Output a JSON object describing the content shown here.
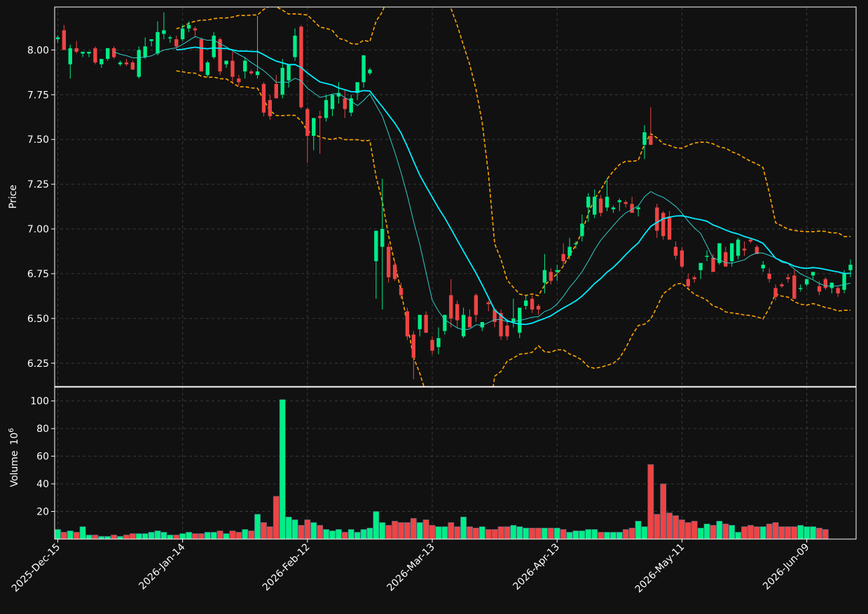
{
  "chart_data": {
    "type": "candlestick",
    "colors": {
      "background": "#111111",
      "up": "#00ee88",
      "down": "#ee4444",
      "ma_fast": "#33cccc",
      "ma_slow": "#00eeff",
      "bands": "#ffa500",
      "grid": "#3a3a3a",
      "axis": "#ffffff"
    },
    "price_panel": {
      "ylabel": "Price",
      "ylim": [
        6.12,
        8.24
      ],
      "yticks": [
        "6.25",
        "6.50",
        "6.75",
        "7.00",
        "7.25",
        "7.50",
        "7.75",
        "8.00"
      ],
      "grid": true
    },
    "volume_panel": {
      "ylabel": "Volume",
      "ylabel_exponent": "10",
      "ylabel_exponent_power": "6",
      "ylim": [
        0,
        110
      ],
      "yticks": [
        "20",
        "40",
        "60",
        "80",
        "100"
      ],
      "grid": true
    },
    "xticks": [
      {
        "label": "2025-Dec-15",
        "index": 0
      },
      {
        "label": "2026-Jan-14",
        "index": 20
      },
      {
        "label": "2026-Feb-12",
        "index": 40
      },
      {
        "label": "2026-Mar-13",
        "index": 60
      },
      {
        "label": "2026-Apr-13",
        "index": 80
      },
      {
        "label": "2026-May-11",
        "index": 100
      },
      {
        "label": "2026-Jun-09",
        "index": 120
      }
    ],
    "ohlc": [
      [
        8.06,
        8.08,
        8.04,
        8.07
      ],
      [
        8.11,
        8.14,
        8.0,
        8.0
      ],
      [
        7.92,
        8.03,
        7.84,
        8.01
      ],
      [
        8.01,
        8.05,
        7.98,
        7.99
      ],
      [
        7.98,
        7.99,
        7.96,
        7.99
      ],
      [
        7.98,
        7.99,
        7.96,
        7.99
      ],
      [
        8.01,
        8.02,
        7.92,
        7.93
      ],
      [
        7.92,
        7.95,
        7.9,
        7.95
      ],
      [
        7.95,
        8.01,
        7.94,
        8.01
      ],
      [
        8.01,
        8.02,
        7.95,
        7.96
      ],
      [
        7.92,
        7.94,
        7.91,
        7.93
      ],
      [
        7.93,
        7.95,
        7.91,
        7.92
      ],
      [
        7.93,
        7.94,
        7.9,
        7.89
      ],
      [
        7.85,
        8.02,
        7.84,
        8.0
      ],
      [
        7.96,
        8.07,
        7.95,
        8.02
      ],
      [
        8.05,
        8.06,
        8.02,
        8.06
      ],
      [
        7.98,
        8.16,
        7.97,
        8.1
      ],
      [
        8.09,
        8.21,
        8.06,
        8.11
      ],
      [
        8.07,
        8.08,
        8.04,
        8.07
      ],
      [
        8.06,
        8.08,
        8.0,
        8.02
      ],
      [
        8.06,
        8.14,
        8.05,
        8.12
      ],
      [
        8.12,
        8.16,
        8.1,
        8.14
      ],
      [
        8.12,
        8.13,
        8.07,
        8.11
      ],
      [
        8.06,
        8.07,
        7.88,
        7.88
      ],
      [
        7.86,
        7.94,
        7.85,
        7.93
      ],
      [
        7.96,
        8.1,
        7.95,
        8.08
      ],
      [
        8.06,
        8.07,
        7.86,
        7.88
      ],
      [
        7.92,
        7.94,
        7.9,
        7.94
      ],
      [
        7.94,
        7.99,
        7.82,
        7.85
      ],
      [
        7.84,
        7.86,
        7.8,
        7.82
      ],
      [
        7.88,
        7.96,
        7.84,
        7.94
      ],
      [
        7.88,
        7.89,
        7.86,
        7.87
      ],
      [
        7.86,
        8.19,
        7.84,
        7.88
      ],
      [
        7.81,
        7.82,
        7.63,
        7.65
      ],
      [
        7.72,
        7.75,
        7.61,
        7.63
      ],
      [
        7.81,
        7.86,
        7.73,
        7.73
      ],
      [
        7.75,
        7.95,
        7.73,
        7.9
      ],
      [
        7.83,
        7.92,
        7.79,
        7.92
      ],
      [
        7.96,
        8.12,
        7.94,
        8.08
      ],
      [
        8.13,
        8.14,
        7.67,
        7.68
      ],
      [
        7.67,
        7.68,
        7.37,
        7.52
      ],
      [
        7.52,
        7.62,
        7.44,
        7.62
      ],
      [
        7.63,
        7.66,
        7.42,
        7.62
      ],
      [
        7.62,
        7.75,
        7.6,
        7.72
      ],
      [
        7.67,
        7.75,
        7.63,
        7.75
      ],
      [
        7.74,
        7.82,
        7.7,
        7.76
      ],
      [
        7.73,
        7.78,
        7.62,
        7.67
      ],
      [
        7.65,
        7.75,
        7.63,
        7.73
      ],
      [
        7.76,
        7.8,
        7.72,
        7.82
      ],
      [
        7.82,
        7.97,
        7.79,
        7.97
      ],
      [
        7.87,
        7.9,
        7.86,
        7.89
      ],
      [
        6.82,
        6.98,
        6.61,
        6.99
      ],
      [
        6.9,
        7.28,
        6.55,
        7.0
      ],
      [
        6.9,
        6.92,
        6.7,
        6.73
      ],
      [
        6.8,
        6.82,
        6.71,
        6.72
      ],
      [
        6.67,
        6.7,
        6.61,
        6.63
      ],
      [
        6.54,
        6.56,
        6.38,
        6.4
      ],
      [
        6.41,
        6.43,
        6.16,
        6.28
      ],
      [
        6.44,
        6.52,
        6.4,
        6.52
      ],
      [
        6.52,
        6.54,
        6.42,
        6.42
      ],
      [
        6.38,
        6.4,
        6.3,
        6.32
      ],
      [
        6.34,
        6.45,
        6.3,
        6.39
      ],
      [
        6.43,
        6.52,
        6.41,
        6.52
      ],
      [
        6.63,
        6.72,
        6.45,
        6.5
      ],
      [
        6.58,
        6.6,
        6.45,
        6.49
      ],
      [
        6.4,
        6.56,
        6.39,
        6.52
      ],
      [
        6.51,
        6.55,
        6.45,
        6.45
      ],
      [
        6.63,
        6.64,
        6.48,
        6.52
      ],
      [
        6.45,
        6.48,
        6.43,
        6.48
      ],
      [
        6.59,
        6.6,
        6.54,
        6.58
      ],
      [
        6.55,
        6.56,
        6.45,
        6.48
      ],
      [
        6.53,
        6.55,
        6.38,
        6.4
      ],
      [
        6.46,
        6.5,
        6.38,
        6.4
      ],
      [
        6.48,
        6.61,
        6.45,
        6.5
      ],
      [
        6.42,
        6.56,
        6.39,
        6.56
      ],
      [
        6.57,
        6.63,
        6.55,
        6.6
      ],
      [
        6.61,
        6.63,
        6.53,
        6.55
      ],
      [
        6.57,
        6.58,
        6.52,
        6.55
      ],
      [
        6.7,
        6.86,
        6.64,
        6.77
      ],
      [
        6.76,
        6.78,
        6.69,
        6.71
      ],
      [
        6.76,
        6.8,
        6.71,
        6.77
      ],
      [
        6.86,
        6.92,
        6.79,
        6.82
      ],
      [
        6.85,
        6.95,
        6.83,
        6.9
      ],
      [
        6.92,
        6.93,
        6.89,
        6.92
      ],
      [
        6.96,
        7.08,
        6.93,
        7.03
      ],
      [
        7.12,
        7.2,
        7.04,
        7.18
      ],
      [
        7.08,
        7.22,
        7.06,
        7.18
      ],
      [
        7.17,
        7.19,
        7.07,
        7.09
      ],
      [
        7.12,
        7.28,
        7.1,
        7.18
      ],
      [
        7.11,
        7.13,
        7.09,
        7.12
      ],
      [
        7.15,
        7.17,
        7.1,
        7.16
      ],
      [
        7.15,
        7.16,
        7.12,
        7.14
      ],
      [
        7.14,
        7.18,
        7.09,
        7.09
      ],
      [
        7.11,
        7.13,
        7.07,
        7.12
      ],
      [
        7.47,
        7.58,
        7.39,
        7.54
      ],
      [
        7.52,
        7.68,
        7.47,
        7.47
      ],
      [
        7.12,
        7.14,
        6.95,
        6.99
      ],
      [
        7.09,
        7.1,
        6.94,
        6.96
      ],
      [
        7.07,
        7.1,
        6.96,
        6.94
      ],
      [
        6.9,
        6.93,
        6.83,
        6.85
      ],
      [
        6.88,
        6.9,
        6.78,
        6.79
      ],
      [
        6.72,
        6.75,
        6.67,
        6.68
      ],
      [
        6.73,
        6.74,
        6.7,
        6.72
      ],
      [
        6.77,
        6.8,
        6.72,
        6.81
      ],
      [
        6.85,
        6.88,
        6.82,
        6.85
      ],
      [
        6.84,
        6.86,
        6.76,
        6.76
      ],
      [
        6.81,
        6.92,
        6.8,
        6.92
      ],
      [
        6.87,
        6.9,
        6.79,
        6.79
      ],
      [
        6.82,
        6.92,
        6.79,
        6.92
      ],
      [
        6.85,
        6.95,
        6.83,
        6.94
      ],
      [
        6.89,
        6.93,
        6.85,
        6.88
      ],
      [
        6.94,
        6.95,
        6.92,
        6.93
      ],
      [
        6.9,
        6.91,
        6.86,
        6.86
      ],
      [
        6.78,
        6.82,
        6.76,
        6.8
      ],
      [
        6.75,
        6.78,
        6.7,
        6.72
      ],
      [
        6.67,
        6.69,
        6.6,
        6.62
      ],
      [
        6.69,
        6.7,
        6.67,
        6.68
      ],
      [
        6.73,
        6.75,
        6.7,
        6.72
      ],
      [
        6.74,
        6.77,
        6.61,
        6.61
      ],
      [
        6.67,
        6.69,
        6.65,
        6.67
      ],
      [
        6.69,
        6.71,
        6.68,
        6.72
      ],
      [
        6.74,
        6.76,
        6.72,
        6.76
      ],
      [
        6.68,
        6.71,
        6.63,
        6.65
      ],
      [
        6.72,
        6.73,
        6.66,
        6.67
      ],
      [
        6.67,
        6.7,
        6.64,
        6.7
      ],
      [
        6.67,
        6.68,
        6.62,
        6.64
      ],
      [
        6.66,
        6.77,
        6.64,
        6.75
      ],
      [
        6.77,
        6.83,
        6.73,
        6.8
      ]
    ],
    "volume": [
      7,
      5,
      6,
      5,
      9,
      3,
      3,
      2,
      2,
      3,
      2,
      3,
      4,
      4,
      4,
      5,
      6,
      5,
      3,
      3,
      4,
      5,
      4,
      4,
      5,
      5,
      6,
      4,
      6,
      5,
      7,
      6,
      18,
      12,
      9,
      31,
      101,
      16,
      14,
      10,
      14,
      12,
      10,
      7,
      6,
      7,
      5,
      7,
      5,
      7,
      8,
      20,
      12,
      10,
      13,
      12,
      12,
      15,
      12,
      14,
      10,
      9,
      9,
      12,
      9,
      16,
      9,
      8,
      9,
      7,
      7,
      9,
      9,
      10,
      9,
      8,
      8,
      8,
      8,
      8,
      8,
      7,
      5,
      6,
      6,
      7,
      7,
      5,
      5,
      5,
      5,
      7,
      8,
      13,
      9,
      54,
      18,
      40,
      19,
      17,
      14,
      12,
      13,
      8,
      11,
      10,
      13,
      11,
      10,
      5,
      9,
      10,
      9,
      9,
      11,
      12,
      9,
      9,
      9,
      10,
      9,
      9,
      8,
      7
    ]
  }
}
